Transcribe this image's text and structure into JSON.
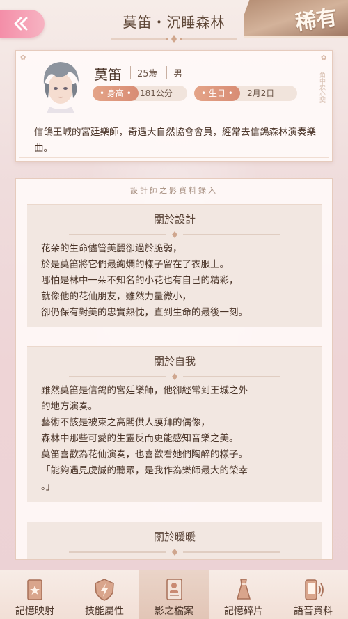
{
  "header": {
    "title": "莫笛・沉睡森林",
    "rarity": "稀有",
    "back_icon": "double-chevron-left-icon"
  },
  "profile": {
    "name": "莫笛",
    "age": "25歲",
    "gender": "男",
    "height_label": "身高",
    "height_value": "181公分",
    "birthday_label": "生日",
    "birthday_value": "2月2日",
    "bio": "信鴿王城的宮廷樂師，奇遇大自然協會會員，經常去信鴿森林演奏樂曲。",
    "side_deco": "角中森心契"
  },
  "records": {
    "header": "設計師之影資料錄入",
    "sections": [
      {
        "title": "關於設計",
        "lines": [
          "花朵的生命儘管美麗卻過於脆弱，",
          "於是莫笛將它們最絢爛的樣子留在了衣服上。",
          "哪怕是林中一朵不知名的小花也有自己的精彩，",
          "就像他的花仙朋友，雖然力量微小，",
          "卻仍保有對美的忠實熱忱，直到生命的最後一刻。"
        ]
      },
      {
        "title": "關於自我",
        "lines": [
          "雖然莫笛是信鴿的宮廷樂師，他卻經常到王城之外",
          "的地方演奏。",
          "藝術不該是被束之高閣供人膜拜的偶像，",
          "森林中那些可愛的生靈反而更能感知音樂之美。",
          "莫笛喜歡為花仙演奏，也喜歡看她們陶醉的樣子。",
          "「能夠遇見虔誠的聽眾，是我作為樂師最大的榮幸",
          "。」"
        ]
      },
      {
        "title": "關於暖暖",
        "lines": []
      }
    ]
  },
  "tabs": [
    {
      "label": "記憶映射",
      "icon": "card-icon"
    },
    {
      "label": "技能屬性",
      "icon": "lightning-shield-icon"
    },
    {
      "label": "影之檔案",
      "icon": "profile-document-icon",
      "active": true
    },
    {
      "label": "記憶碎片",
      "icon": "dress-icon"
    },
    {
      "label": "語音資料",
      "icon": "phone-voice-icon"
    }
  ],
  "colors": {
    "accent_pink": "#f48ea8",
    "tag_orange": "#d88c74",
    "text_brown": "#4a3428",
    "rarity_gold": "#b28a70"
  }
}
